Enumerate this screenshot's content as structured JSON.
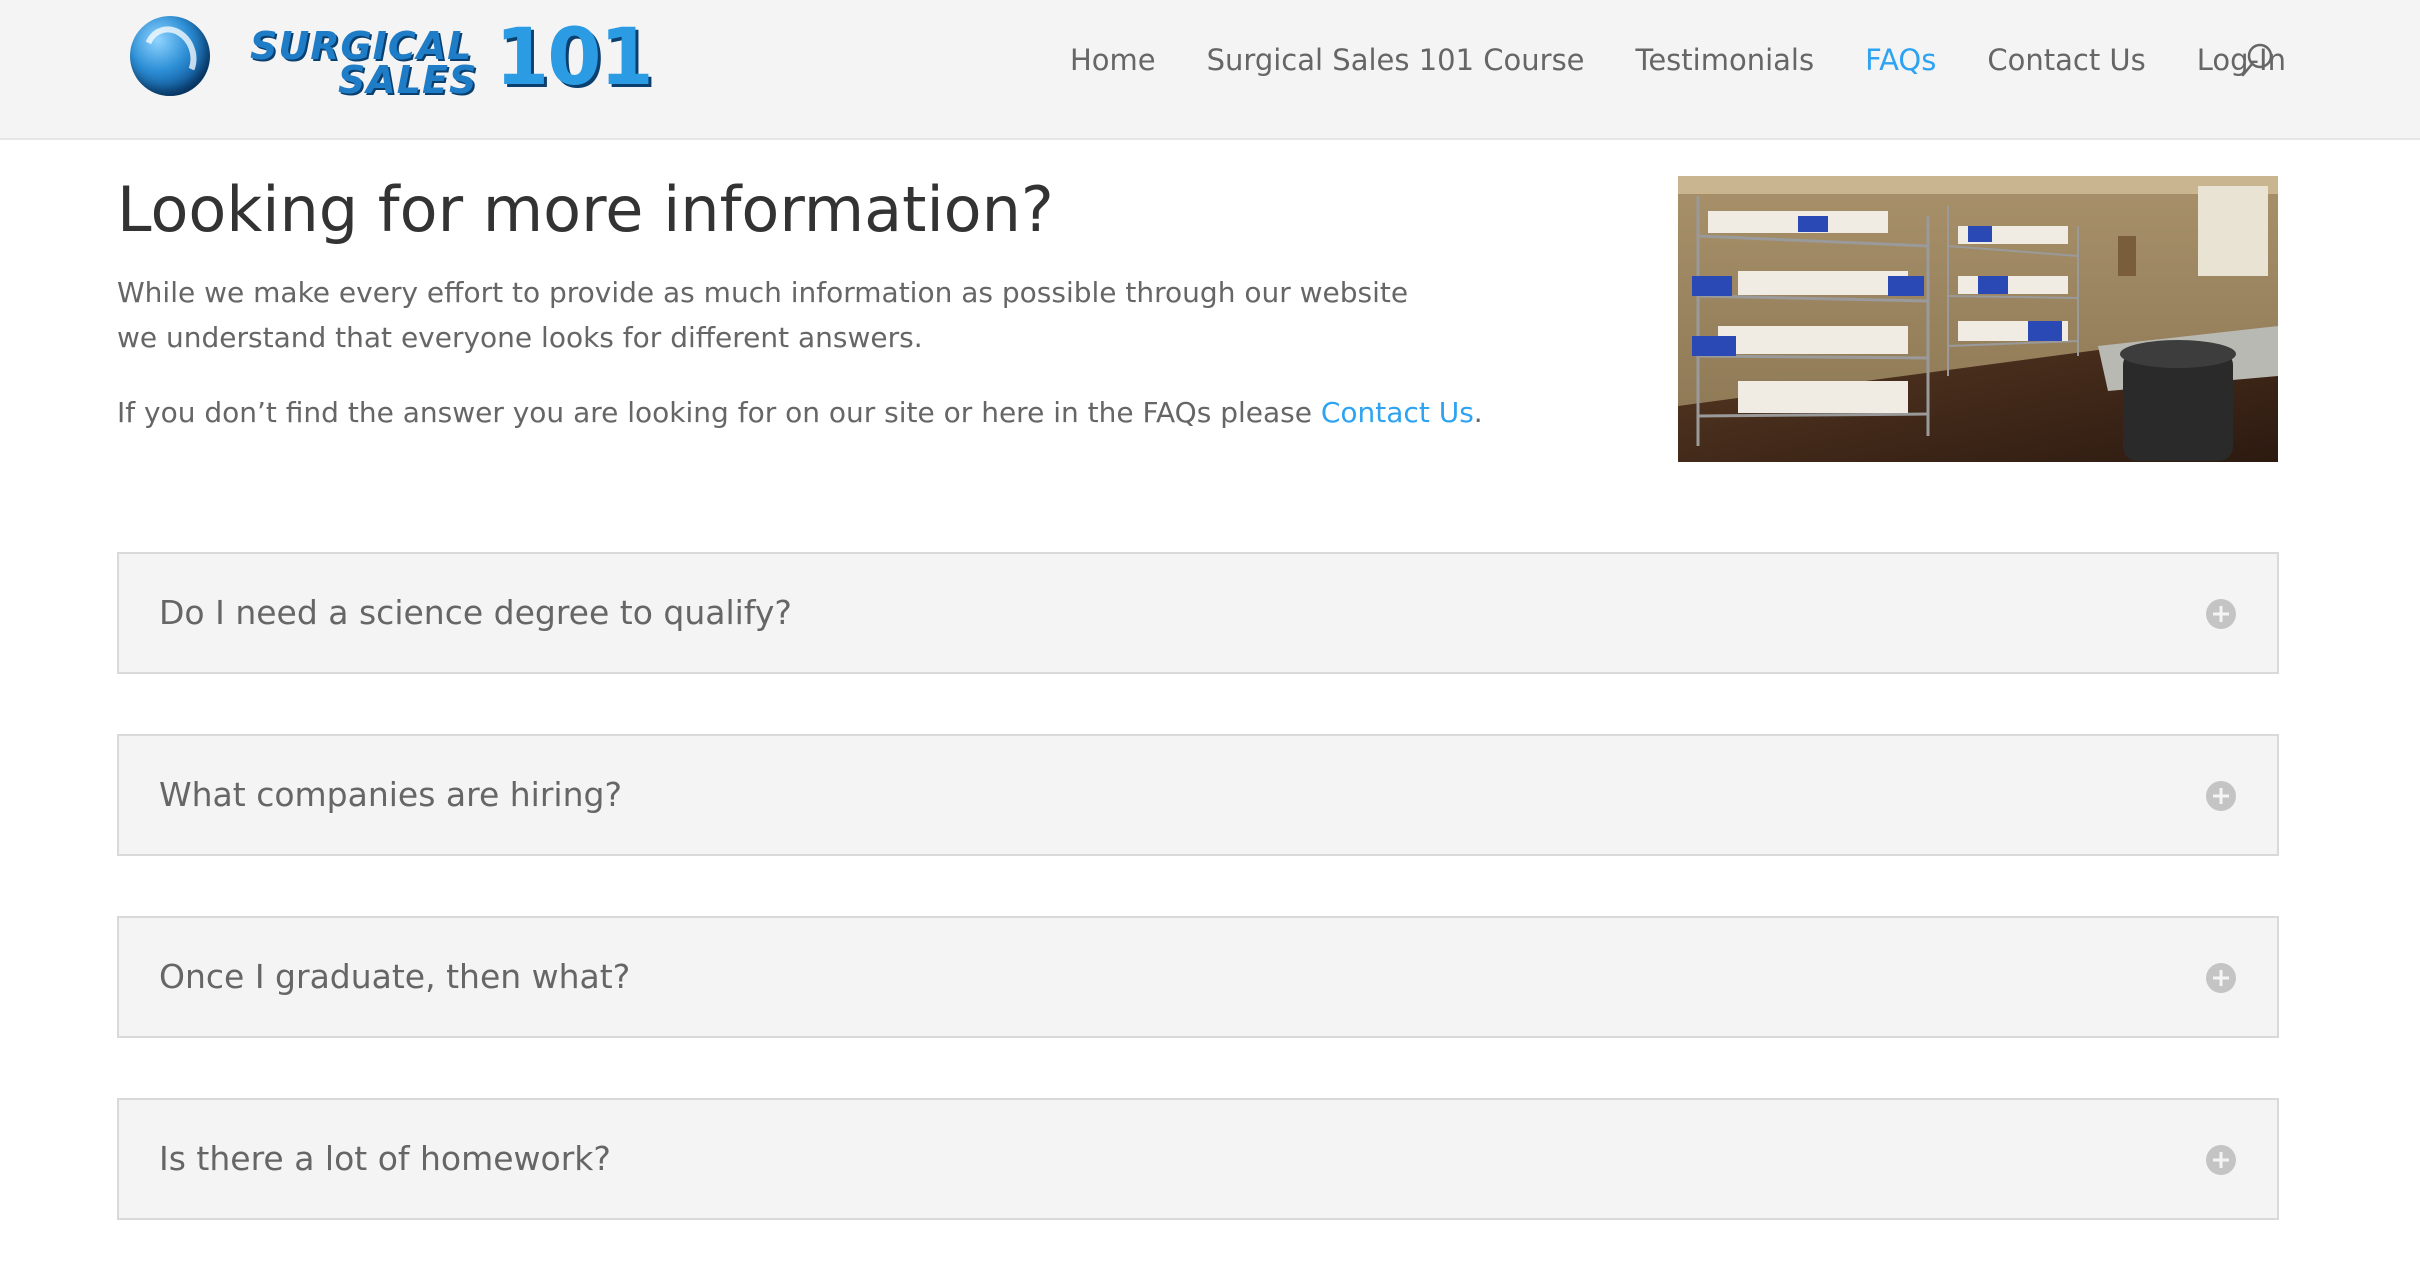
{
  "header": {
    "logo": {
      "word1": "SURGICAL",
      "word2": "SALES",
      "number": "101"
    },
    "nav": [
      {
        "label": "Home",
        "active": false
      },
      {
        "label": "Surgical Sales 101 Course",
        "active": false
      },
      {
        "label": "Testimonials",
        "active": false
      },
      {
        "label": "FAQs",
        "active": true
      },
      {
        "label": "Contact Us",
        "active": false
      },
      {
        "label": "Log-In",
        "active": false
      }
    ],
    "search_icon": "search-icon"
  },
  "intro": {
    "title": "Looking for more information?",
    "paragraph1": "While we make every effort to provide as much information as possible through our website we understand that everyone looks for different answers.",
    "paragraph2_prefix": "If you don’t find the answer you are looking for on our site or here in the FAQs please ",
    "paragraph2_link": "Contact Us",
    "paragraph2_suffix": "."
  },
  "faqs": [
    {
      "question": "Do I need a science degree to qualify?",
      "toggle_icon": "plus-circle-icon"
    },
    {
      "question": "What companies are hiring?",
      "toggle_icon": "plus-circle-icon"
    },
    {
      "question": "Once I graduate, then what?",
      "toggle_icon": "plus-circle-icon"
    },
    {
      "question": "Is there a lot of homework?",
      "toggle_icon": "plus-circle-icon"
    }
  ],
  "colors": {
    "accent": "#2ea3f2",
    "text": "#666666",
    "heading": "#333333",
    "header_bg": "#f4f4f4",
    "accordion_bg": "#f4f4f4",
    "accordion_border": "#d9d9d9",
    "toggle_icon": "#c4c4c4"
  }
}
